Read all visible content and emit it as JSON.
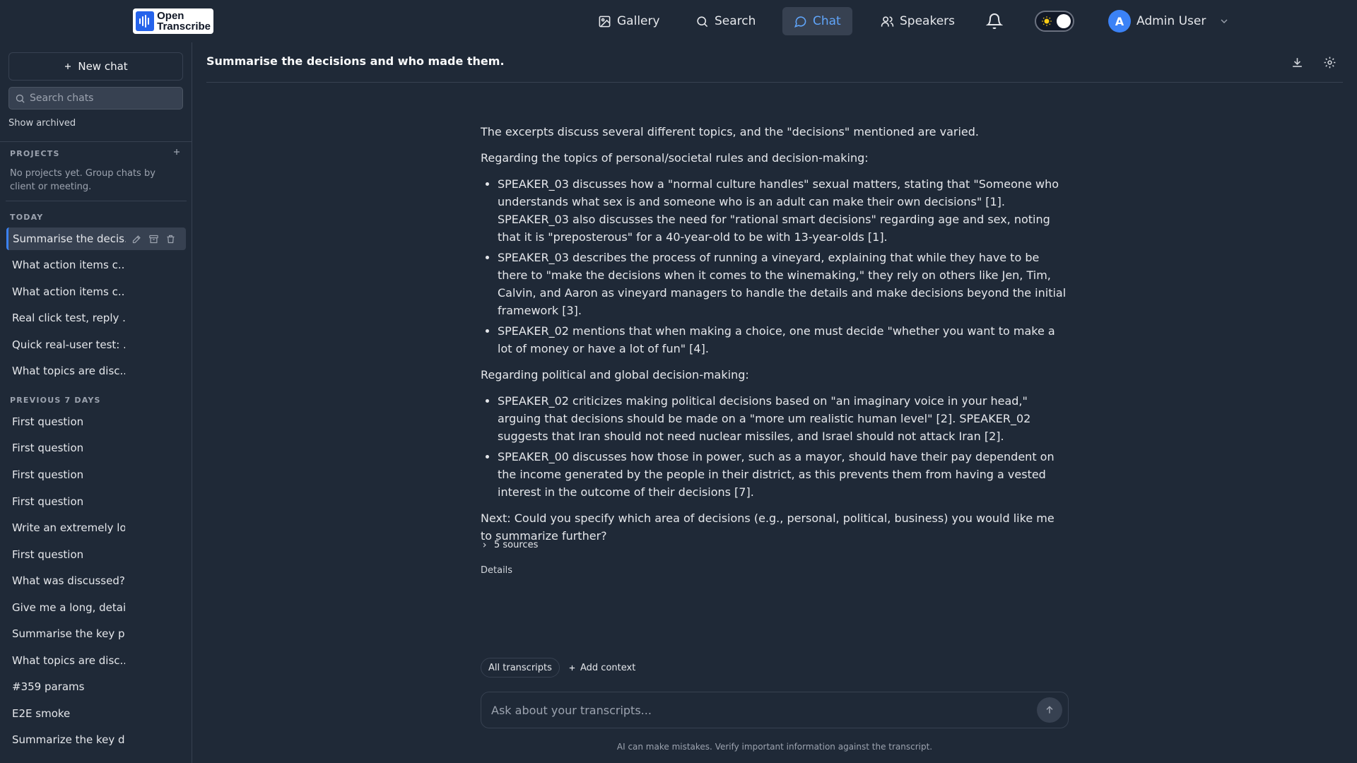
{
  "brand": {
    "line1": "Open",
    "line2": "Transcribe"
  },
  "nav": {
    "gallery": "Gallery",
    "search": "Search",
    "chat": "Chat",
    "speakers": "Speakers"
  },
  "user": {
    "initial": "A",
    "name": "Admin User"
  },
  "sidebar": {
    "new_chat": "New chat",
    "search_placeholder": "Search chats",
    "show_archived": "Show archived",
    "projects_label": "PROJECTS",
    "projects_empty": "No projects yet. Group chats by client or meeting.",
    "today_label": "TODAY",
    "previous_label": "PREVIOUS 7 DAYS",
    "today_items": [
      "Summarise the decis...",
      "What action items c...",
      "What action items c...",
      "Real click test, reply ...",
      "Quick real-user test: ...",
      "What topics are disc..."
    ],
    "previous_items": [
      "First question",
      "First question",
      "First question",
      "First question",
      "Write an extremely lo...",
      "First question",
      "What was discussed?",
      "Give me a long, detai...",
      "Summarise the key p...",
      "What topics are disc...",
      "#359 params",
      "E2E smoke",
      "Summarize the key d..."
    ]
  },
  "conversation": {
    "title": "Summarise the decisions and who made them.",
    "intro": "The excerpts discuss several different topics, and the \"decisions\" mentioned are varied.",
    "section1": "Regarding the topics of personal/societal rules and decision-making:",
    "bullets1": [
      "SPEAKER_03 discusses how a \"normal culture handles\" sexual matters, stating that \"Someone who understands what sex is and someone who is an adult can make their own decisions\" [1]. SPEAKER_03 also discusses the need for \"rational smart decisions\" regarding age and sex, noting that it is \"preposterous\" for a 40-year-old to be with 13-year-olds [1].",
      "SPEAKER_03 describes the process of running a vineyard, explaining that while they have to be there to \"make the decisions when it comes to the winemaking,\" they rely on others like Jen, Tim, Calvin, and Aaron as vineyard managers to handle the details and make decisions beyond the initial framework [3].",
      "SPEAKER_02 mentions that when making a choice, one must decide \"whether you want to make a lot of money or have a lot of fun\" [4]."
    ],
    "section2": "Regarding political and global decision-making:",
    "bullets2": [
      "SPEAKER_02 criticizes making political decisions based on \"an imaginary voice in your head,\" arguing that decisions should be made on a \"more um realistic human level\" [2]. SPEAKER_02 suggests that Iran should not need nuclear missiles, and Israel should not attack Iran [2].",
      "SPEAKER_00 discusses how those in power, such as a mayor, should have their pay dependent on the income generated by the people in their district, as this prevents them from having a vested interest in the outcome of their decisions [7]."
    ],
    "next": "Next: Could you specify which area of decisions (e.g., personal, political, business) you would like me to summarize further?",
    "sources": "5 sources",
    "details": "Details"
  },
  "composer": {
    "scope_chip": "All transcripts",
    "add_context": "Add context",
    "placeholder": "Ask about your transcripts...",
    "disclaimer": "AI can make mistakes. Verify important information against the transcript."
  },
  "colors": {
    "background": "#1f2937",
    "accent": "#3b82f6",
    "active_nav_text": "#60a5fa"
  },
  "icons": [
    "image-icon",
    "search-icon",
    "chat-bubble-icon",
    "users-icon",
    "bell-icon",
    "sun-icon",
    "chevron-down-icon",
    "plus-icon",
    "pencil-icon",
    "archive-icon",
    "trash-icon",
    "download-icon",
    "gear-icon",
    "chevron-right-icon",
    "arrow-up-icon"
  ]
}
